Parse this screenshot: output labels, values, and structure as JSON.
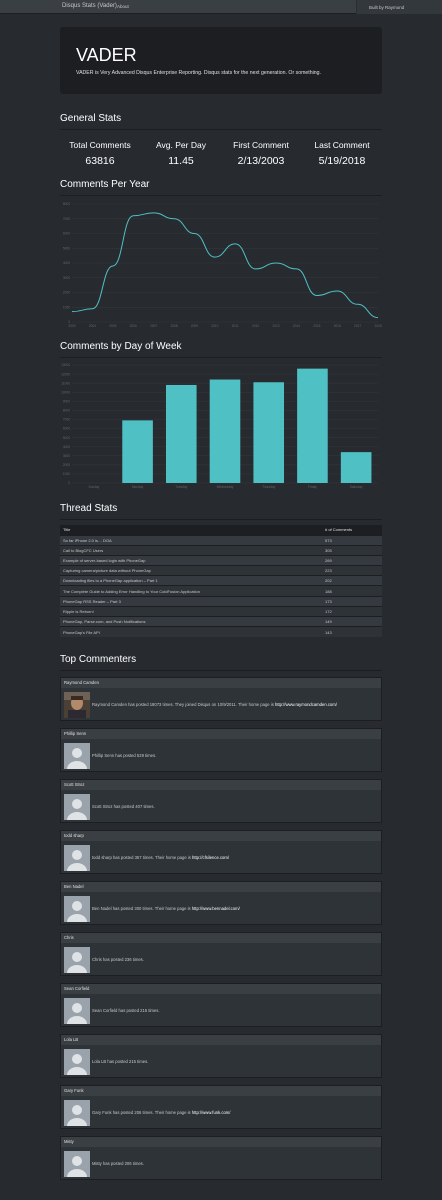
{
  "nav": {
    "brand": "Disqus Stats (Vader)",
    "about": "About",
    "built_by": "Built by Raymond"
  },
  "jumbotron": {
    "title": "VADER",
    "tagline": "VADER is Very Advanced Disqus Enterprise Reporting. Disqus stats for the next generation. Or something."
  },
  "general": {
    "heading": "General Stats",
    "stats": [
      {
        "label": "Total Comments",
        "value": "63816"
      },
      {
        "label": "Avg. Per Day",
        "value": "11.45"
      },
      {
        "label": "First Comment",
        "value": "2/13/2003"
      },
      {
        "label": "Last Comment",
        "value": "5/19/2018"
      }
    ]
  },
  "per_year": {
    "heading": "Comments Per Year"
  },
  "by_day": {
    "heading": "Comments by Day of Week"
  },
  "chart_data": [
    {
      "type": "line",
      "x": [
        "2003",
        "2004",
        "2005",
        "2006",
        "2007",
        "2008",
        "2009",
        "2010",
        "2011",
        "2012",
        "2013",
        "2014",
        "2015",
        "2016",
        "2017",
        "2018"
      ],
      "values": [
        700,
        900,
        3800,
        7200,
        7400,
        7000,
        6000,
        4400,
        5300,
        3600,
        4000,
        3600,
        1800,
        2100,
        1200,
        300
      ],
      "yticks": [
        "0",
        "1000",
        "2000",
        "3000",
        "4000",
        "5000",
        "6000",
        "7000",
        "8000"
      ],
      "ylim": [
        0,
        8000
      ],
      "color": "#4fc1c4",
      "grid": true
    },
    {
      "type": "bar",
      "categories": [
        "Sunday",
        "Monday",
        "Tuesday",
        "Wednesday",
        "Thursday",
        "Friday",
        "Saturday"
      ],
      "values": [
        0,
        6900,
        10800,
        11400,
        11100,
        12600,
        3400
      ],
      "yticks": [
        "0",
        "1000",
        "2000",
        "3000",
        "4000",
        "5000",
        "6000",
        "7000",
        "8000",
        "9000",
        "10000",
        "11000",
        "12000",
        "13000"
      ],
      "ylim": [
        0,
        13000
      ],
      "color": "#4fc1c4",
      "grid": true
    }
  ],
  "threads": {
    "heading": "Thread Stats",
    "col_title": "Title",
    "col_count": "# of Comments",
    "rows": [
      {
        "title": "So far iPhone 2.0 is… DOA",
        "count": "573"
      },
      {
        "title": "Call to BlogCFC Users",
        "count": "305"
      },
      {
        "title": "Example of server-based login with PhoneGap",
        "count": "269"
      },
      {
        "title": "Capturing camera/picture data without PhoneGap",
        "count": "223"
      },
      {
        "title": "Downloading files to a PhoneGap application – Part 1",
        "count": "202"
      },
      {
        "title": "The Complete Guide to Adding Error Handling to Your ColdFusion Application",
        "count": "188"
      },
      {
        "title": "PhoneGap RSS Reader – Part 3",
        "count": "173"
      },
      {
        "title": "Ripple is Reborn!",
        "count": "172"
      },
      {
        "title": "PhoneGap, Parse.com, and Push Notifications",
        "count": "149"
      },
      {
        "title": "PhoneGap's File API",
        "count": "143"
      }
    ]
  },
  "commenters": {
    "heading": "Top Commenters",
    "items": [
      {
        "name": "Raymond Camden",
        "text": "Raymond Camden has posted 18073 times. They joined Disqus on 10/9/2011. Their home page is",
        "link": "http://www.raymondcamden.com/"
      },
      {
        "name": "Phillip Senn",
        "text": "Phillip Senn has posted 529 times.",
        "link": ""
      },
      {
        "name": "Scott Stroz",
        "text": "Scott Stroz has posted 407 times.",
        "link": ""
      },
      {
        "name": "todd sharp",
        "text": "todd sharp has posted 357 times. Their home page is",
        "link": "http://cfsilence.com/"
      },
      {
        "name": "Ben Nadel",
        "text": "Ben Nadel has posted 300 times. Their home page is",
        "link": "http://www.bennadel.com/"
      },
      {
        "name": "Chris",
        "text": "Chris has posted 236 times.",
        "link": ""
      },
      {
        "name": "Sean Corfield",
        "text": "Sean Corfield has posted 215 times.",
        "link": ""
      },
      {
        "name": "Lola LB",
        "text": "Lola LB has posted 215 times.",
        "link": ""
      },
      {
        "name": "Gary Funk",
        "text": "Gary Funk has posted 206 times. Their home page is",
        "link": "http://www.funk.com/"
      },
      {
        "name": "Misty",
        "text": "Misty has posted 206 times.",
        "link": ""
      }
    ]
  }
}
